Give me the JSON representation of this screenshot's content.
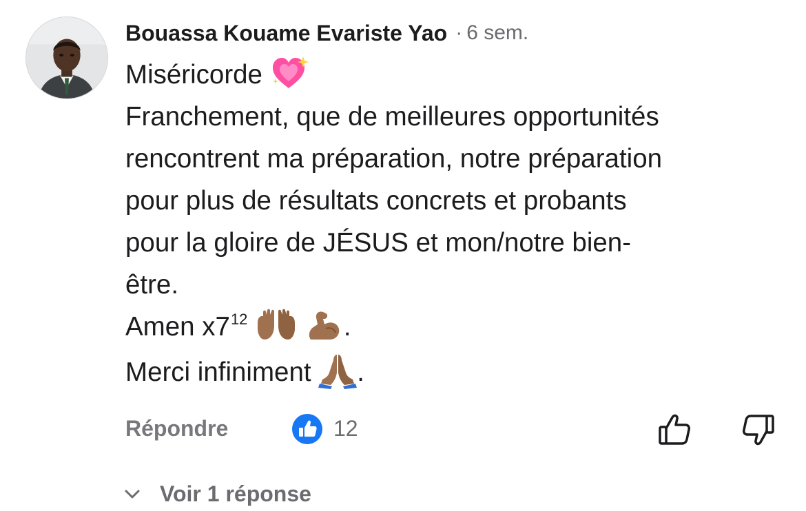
{
  "comment": {
    "author": "Bouassa Kouame Evariste Yao",
    "separator": "·",
    "time": "6 sem.",
    "body": {
      "line1": "Miséricorde",
      "line2": "Franchement, que de meilleures opportunités",
      "line3": "rencontrent ma préparation, notre préparation",
      "line4": "pour plus de résultats concrets et probants",
      "line5": "pour la gloire de JÉSUS et mon/notre bien-",
      "line6": "être.",
      "line7_text": "Amen x7",
      "line7_sup": "12",
      "line7_end": ".",
      "line8_text": "Merci infiniment",
      "line8_end": "."
    },
    "emojis": {
      "heart": "sparkling-heart-icon",
      "hands": "open-hands-icon",
      "muscle": "flexed-biceps-icon",
      "pray": "folded-hands-icon"
    }
  },
  "actions": {
    "reply_label": "Répondre",
    "like_count": "12",
    "like_badge_icon": "like-badge-icon",
    "thumbs_up_icon": "thumbs-up-icon",
    "thumbs_down_icon": "thumbs-down-icon"
  },
  "replies": {
    "label": "Voir 1 réponse",
    "icon": "chevron-down-icon"
  },
  "colors": {
    "text": "#1c1c1e",
    "muted": "#6b6b70",
    "like_blue": "#1877f2",
    "heart_pink": "#ff4fa3",
    "skin_tone": "#a0714f"
  }
}
